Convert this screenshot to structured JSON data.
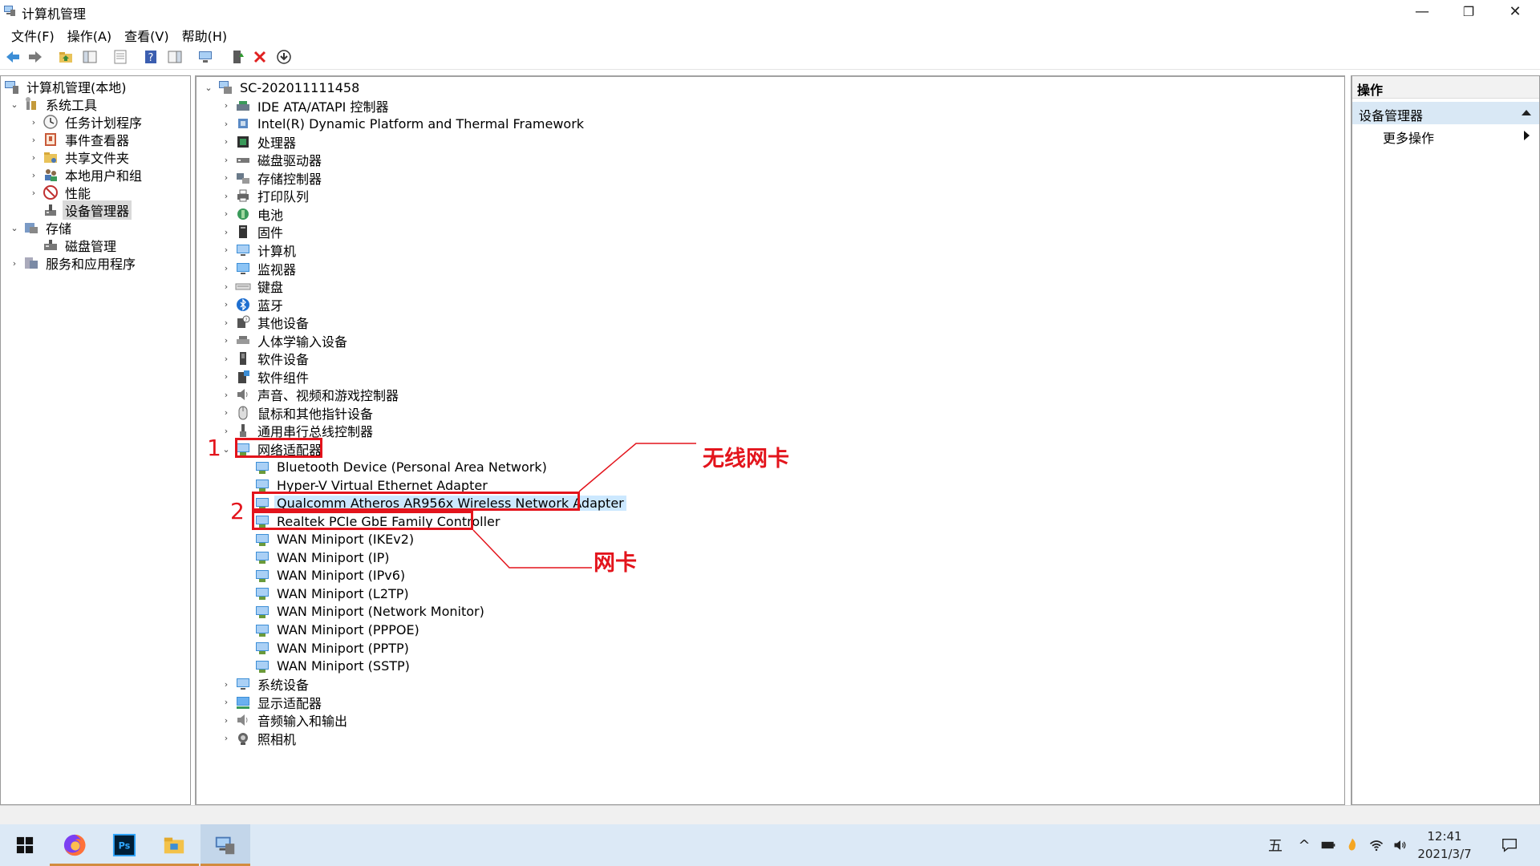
{
  "window": {
    "title": "计算机管理",
    "minimize": "—",
    "restore": "❐",
    "close": "✕"
  },
  "menu": [
    "文件(F)",
    "操作(A)",
    "查看(V)",
    "帮助(H)"
  ],
  "left_tree": [
    {
      "label": "计算机管理(本地)",
      "icon": "computer-management-icon",
      "level": 0,
      "twisty": ""
    },
    {
      "label": "系统工具",
      "icon": "system-tools-icon",
      "level": 1,
      "twisty": "⌄"
    },
    {
      "label": "任务计划程序",
      "icon": "clock-icon",
      "level": 2,
      "twisty": "›"
    },
    {
      "label": "事件查看器",
      "icon": "event-viewer-icon",
      "level": 2,
      "twisty": "›"
    },
    {
      "label": "共享文件夹",
      "icon": "shared-folder-icon",
      "level": 2,
      "twisty": "›"
    },
    {
      "label": "本地用户和组",
      "icon": "users-icon",
      "level": 2,
      "twisty": "›"
    },
    {
      "label": "性能",
      "icon": "performance-icon",
      "level": 2,
      "twisty": "›"
    },
    {
      "label": "设备管理器",
      "icon": "device-manager-icon",
      "level": 2,
      "twisty": "",
      "selected": true
    },
    {
      "label": "存储",
      "icon": "storage-icon",
      "level": 1,
      "twisty": "⌄"
    },
    {
      "label": "磁盘管理",
      "icon": "disk-management-icon",
      "level": 2,
      "twisty": ""
    },
    {
      "label": "服务和应用程序",
      "icon": "services-icon",
      "level": 1,
      "twisty": "›"
    }
  ],
  "device_tree": {
    "root": "SC-202011111458",
    "categories": [
      {
        "label": "IDE ATA/ATAPI 控制器",
        "icon": "ide-controller-icon"
      },
      {
        "label": "Intel(R) Dynamic Platform and Thermal Framework",
        "icon": "chip-icon"
      },
      {
        "label": "处理器",
        "icon": "processor-icon"
      },
      {
        "label": "磁盘驱动器",
        "icon": "disk-drive-icon"
      },
      {
        "label": "存储控制器",
        "icon": "storage-controller-icon"
      },
      {
        "label": "打印队列",
        "icon": "printer-icon"
      },
      {
        "label": "电池",
        "icon": "battery-icon"
      },
      {
        "label": "固件",
        "icon": "firmware-icon"
      },
      {
        "label": "计算机",
        "icon": "computer-icon"
      },
      {
        "label": "监视器",
        "icon": "monitor-icon"
      },
      {
        "label": "键盘",
        "icon": "keyboard-icon"
      },
      {
        "label": "蓝牙",
        "icon": "bluetooth-icon"
      },
      {
        "label": "其他设备",
        "icon": "other-devices-icon"
      },
      {
        "label": "人体学输入设备",
        "icon": "hid-icon"
      },
      {
        "label": "软件设备",
        "icon": "software-device-icon"
      },
      {
        "label": "软件组件",
        "icon": "software-component-icon"
      },
      {
        "label": "声音、视频和游戏控制器",
        "icon": "sound-icon"
      },
      {
        "label": "鼠标和其他指针设备",
        "icon": "mouse-icon"
      },
      {
        "label": "通用串行总线控制器",
        "icon": "usb-icon"
      }
    ],
    "network_category": "网络适配器",
    "network_adapters": [
      "Bluetooth Device (Personal Area Network)",
      "Hyper-V Virtual Ethernet Adapter",
      "Qualcomm Atheros AR956x Wireless Network Adapter",
      "Realtek PCIe GbE Family Controller",
      "WAN Miniport (IKEv2)",
      "WAN Miniport (IP)",
      "WAN Miniport (IPv6)",
      "WAN Miniport (L2TP)",
      "WAN Miniport (Network Monitor)",
      "WAN Miniport (PPPOE)",
      "WAN Miniport (PPTP)",
      "WAN Miniport (SSTP)"
    ],
    "trailing_categories": [
      {
        "label": "系统设备",
        "icon": "system-device-icon"
      },
      {
        "label": "显示适配器",
        "icon": "display-adapter-icon"
      },
      {
        "label": "音频输入和输出",
        "icon": "audio-icon"
      },
      {
        "label": "照相机",
        "icon": "camera-icon"
      }
    ]
  },
  "actions": {
    "header": "操作",
    "section": "设备管理器",
    "more": "更多操作"
  },
  "annotations": {
    "num1": "1",
    "num2": "2",
    "wireless": "无线网卡",
    "wired": "网卡",
    "color": "#e3141c"
  },
  "taskbar": {
    "ime": "五",
    "chevron": "^",
    "time": "12:41",
    "date": "2021/3/7"
  },
  "colors": {
    "selection_blue": "#cce8ff",
    "selection_gray": "#d9d9d9",
    "taskbar": "#dce9f6",
    "actions_section": "#d9e8f5"
  }
}
